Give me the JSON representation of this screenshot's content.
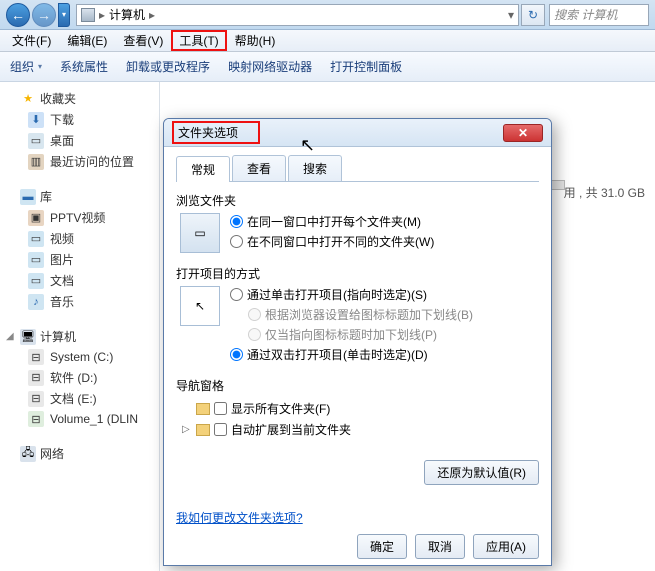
{
  "titlebar": {
    "breadcrumb": "计算机",
    "search_placeholder": "搜索 计算机"
  },
  "menubar": {
    "file": "文件(F)",
    "edit": "编辑(E)",
    "view": "查看(V)",
    "tools": "工具(T)",
    "help": "帮助(H)"
  },
  "toolbar": {
    "organize": "组织",
    "props": "系统属性",
    "uninstall": "卸载或更改程序",
    "map": "映射网络驱动器",
    "cp": "打开控制面板"
  },
  "sidebar": {
    "favorites": "收藏夹",
    "downloads": "下载",
    "desktop": "桌面",
    "recent": "最近访问的位置",
    "library": "库",
    "pptv": "PPTV视频",
    "video": "视频",
    "picture": "图片",
    "document": "文档",
    "music": "音乐",
    "computer": "计算机",
    "system": "System (C:)",
    "soft": "软件 (D:)",
    "docs": "文档 (E:)",
    "vol": "Volume_1 (DLIN",
    "network": "网络"
  },
  "drive_info": "用 , 共 31.0 GB",
  "dialog": {
    "title": "文件夹选项",
    "tabs": {
      "general": "常规",
      "view": "查看",
      "search": "搜索"
    },
    "browse": {
      "title": "浏览文件夹",
      "same": "在同一窗口中打开每个文件夹(M)",
      "own": "在不同窗口中打开不同的文件夹(W)"
    },
    "click": {
      "title": "打开项目的方式",
      "single": "通过单击打开项目(指向时选定)(S)",
      "under_browser": "根据浏览器设置给图标标题加下划线(B)",
      "under_point": "仅当指向图标标题时加下划线(P)",
      "double": "通过双击打开项目(单击时选定)(D)"
    },
    "navpane": {
      "title": "导航窗格",
      "showall": "显示所有文件夹(F)",
      "autoexp": "自动扩展到当前文件夹"
    },
    "restore": "还原为默认值(R)",
    "link": "我如何更改文件夹选项?",
    "ok": "确定",
    "cancel": "取消",
    "apply": "应用(A)"
  }
}
